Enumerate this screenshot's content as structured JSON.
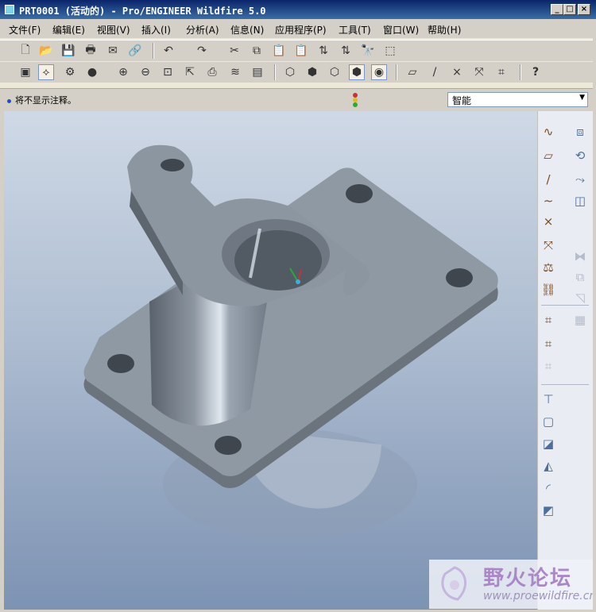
{
  "window": {
    "title": "PRT0001 (活动的) - Pro/ENGINEER Wildfire 5.0",
    "controls": [
      "_",
      "□",
      "×"
    ]
  },
  "menu": [
    "文件(F)",
    "编辑(E)",
    "视图(V)",
    "插入(I)",
    "分析(A)",
    "信息(N)",
    "应用程序(P)",
    "工具(T)",
    "窗口(W)",
    "帮助(H)"
  ],
  "toolbar1": [
    {
      "name": "new-icon",
      "glyph": "🗋"
    },
    {
      "name": "open-icon",
      "glyph": "📂"
    },
    {
      "name": "save-icon",
      "glyph": "💾"
    },
    {
      "name": "print-icon",
      "glyph": "🖶"
    },
    {
      "name": "send-mail-icon",
      "glyph": "✉"
    },
    {
      "name": "send-link-icon",
      "glyph": "🔗"
    },
    {
      "name": "undo-icon",
      "glyph": "↶"
    },
    {
      "name": "redo-icon",
      "glyph": "↷"
    },
    {
      "name": "cut-icon",
      "glyph": "✂"
    },
    {
      "name": "copy-icon",
      "glyph": "⧉"
    },
    {
      "name": "paste-icon",
      "glyph": "📋"
    },
    {
      "name": "paste-special-icon",
      "glyph": "📋"
    },
    {
      "name": "regenerate-icon",
      "glyph": "⇅"
    },
    {
      "name": "regen-manager-icon",
      "glyph": "⇅"
    },
    {
      "name": "find-icon",
      "glyph": "🔭"
    },
    {
      "name": "select-box-icon",
      "glyph": "⬚"
    }
  ],
  "toolbar2": [
    {
      "name": "refit-icon",
      "glyph": "▣"
    },
    {
      "name": "spin-center-icon",
      "glyph": "⟡",
      "active": true
    },
    {
      "name": "orient-mode-icon",
      "glyph": "⚙"
    },
    {
      "name": "appearance-icon",
      "glyph": "●"
    },
    {
      "name": "zoom-in-icon",
      "glyph": "⊕"
    },
    {
      "name": "zoom-out-icon",
      "glyph": "⊖"
    },
    {
      "name": "fit-icon",
      "glyph": "⊡"
    },
    {
      "name": "reorient-icon",
      "glyph": "⇱"
    },
    {
      "name": "saved-views-icon",
      "glyph": "⎙"
    },
    {
      "name": "layers-icon",
      "glyph": "≋"
    },
    {
      "name": "view-manager-icon",
      "glyph": "▤"
    },
    {
      "name": "wireframe-icon",
      "glyph": "⬡"
    },
    {
      "name": "hidden-line-icon",
      "glyph": "⬢"
    },
    {
      "name": "no-hidden-icon",
      "glyph": "⬡"
    },
    {
      "name": "shading-icon",
      "glyph": "⬢",
      "active": true
    },
    {
      "name": "enhanced-realism-icon",
      "glyph": "◉",
      "active": true
    },
    {
      "name": "datum-planes-icon",
      "glyph": "▱"
    },
    {
      "name": "datum-axes-icon",
      "glyph": "/"
    },
    {
      "name": "datum-points-icon",
      "glyph": "×"
    },
    {
      "name": "csys-icon",
      "glyph": "⤧"
    },
    {
      "name": "annotations-icon",
      "glyph": "⌗"
    },
    {
      "name": "whats-this-icon",
      "glyph": "?"
    }
  ],
  "message": "将不显示注释。",
  "filter": {
    "value": "智能"
  },
  "right_toolbar": [
    {
      "name": "sketch-datum-curve-icon",
      "glyph": "∿"
    },
    {
      "name": "extrude-icon",
      "glyph": "⧈"
    },
    {
      "name": "datum-plane-icon",
      "glyph": "▱"
    },
    {
      "name": "revolve-icon",
      "glyph": "⟲"
    },
    {
      "name": "datum-axis-icon",
      "glyph": "/"
    },
    {
      "name": "sweep-icon",
      "glyph": "⤳"
    },
    {
      "name": "datum-curve-icon",
      "glyph": "∼"
    },
    {
      "name": "boundary-blend-icon",
      "glyph": "◫"
    },
    {
      "name": "datum-point-icon",
      "glyph": "×"
    },
    {
      "name": "csys-tool-icon",
      "glyph": "⤧"
    },
    {
      "name": "mirror-icon",
      "glyph": "⧓"
    },
    {
      "name": "merge-icon",
      "glyph": "⧉"
    },
    {
      "name": "analysis-feature-icon",
      "glyph": "⚖"
    },
    {
      "name": "trim-icon",
      "glyph": "◹"
    },
    {
      "name": "pattern-icon",
      "glyph": "▦"
    },
    {
      "name": "chain-icon",
      "glyph": "⛓"
    },
    {
      "name": "annotation-feature-icon",
      "glyph": "⌗"
    },
    {
      "name": "datum-tag-icon",
      "glyph": "⌗"
    },
    {
      "name": "cosmetic-icon",
      "glyph": "⌗"
    },
    {
      "name": "hole-icon",
      "glyph": "⊤"
    },
    {
      "name": "shell-icon",
      "glyph": "▢"
    },
    {
      "name": "rib-icon",
      "glyph": "◪"
    },
    {
      "name": "draft-icon",
      "glyph": "◭"
    },
    {
      "name": "round-icon",
      "glyph": "◜"
    },
    {
      "name": "chamfer-icon",
      "glyph": "◩"
    }
  ],
  "watermark": {
    "text": "野火论坛",
    "url": "www.proewildfire.cn"
  },
  "colors": {
    "title_bar_start": "#0a246a",
    "title_bar_end": "#3a6ea5",
    "model": "#8e98a3",
    "viewport_top": "#cfd9e6",
    "viewport_bottom": "#7d93b3"
  }
}
